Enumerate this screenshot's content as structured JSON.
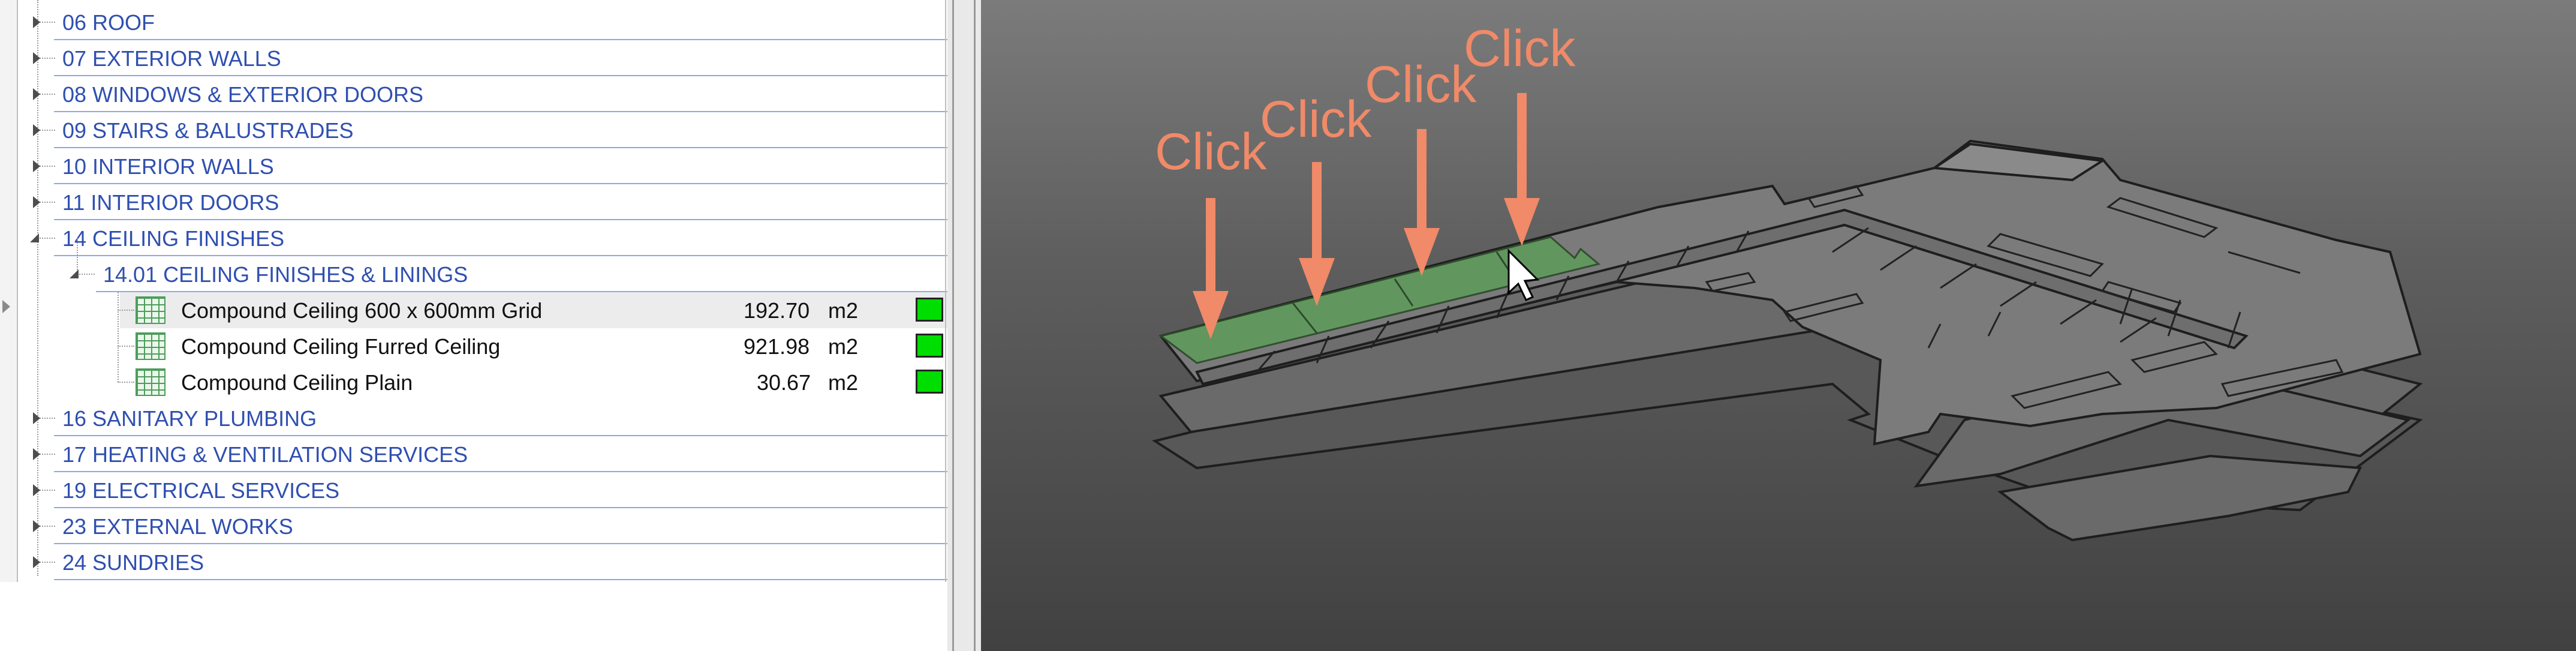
{
  "tree": {
    "categories": [
      {
        "label": "06 ROOF"
      },
      {
        "label": "07 EXTERIOR WALLS"
      },
      {
        "label": "08 WINDOWS & EXTERIOR DOORS"
      },
      {
        "label": "09 STAIRS & BALUSTRADES"
      },
      {
        "label": "10 INTERIOR WALLS"
      },
      {
        "label": "11 INTERIOR DOORS"
      },
      {
        "label": "14 CEILING FINISHES"
      }
    ],
    "subcategory": {
      "label": "14.01 CEILING FINISHES & LININGS"
    },
    "items": [
      {
        "label": "Compound Ceiling 600 x 600mm Grid",
        "qty": "192.70",
        "unit": "m2"
      },
      {
        "label": "Compound Ceiling Furred Ceiling",
        "qty": "921.98",
        "unit": "m2"
      },
      {
        "label": "Compound Ceiling Plain",
        "qty": "30.67",
        "unit": "m2"
      }
    ],
    "categories_after": [
      {
        "label": "16 SANITARY PLUMBING"
      },
      {
        "label": "17 HEATING & VENTILATION SERVICES"
      },
      {
        "label": "19 ELECTRICAL SERVICES"
      },
      {
        "label": "23 EXTERNAL WORKS"
      },
      {
        "label": "24 SUNDRIES"
      }
    ]
  },
  "viewport": {
    "annotations": [
      "Click",
      "Click",
      "Click",
      "Click"
    ]
  },
  "colors": {
    "category_text": "#2f4fb0",
    "swatch_green": "#00dd00",
    "annotation": "#f08a68",
    "highlight": "#5f9a5c"
  }
}
